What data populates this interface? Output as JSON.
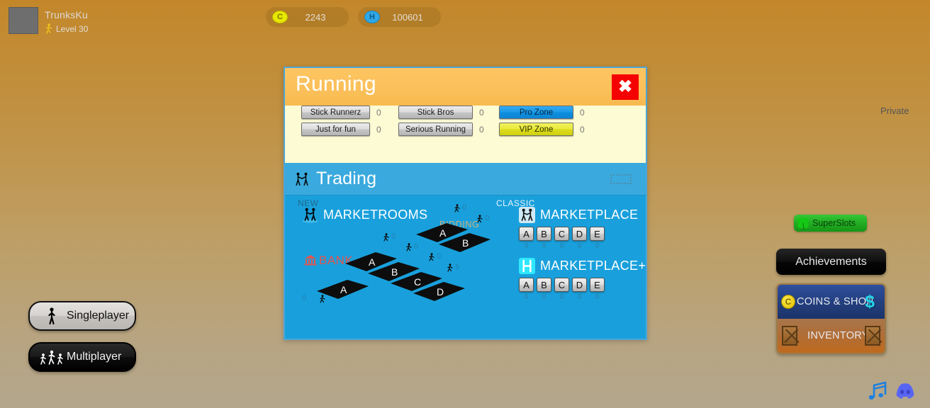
{
  "topbar": {
    "player_name": "TrunksKu",
    "level_text": "Level 30",
    "avatar_icon": "avatar-placeholder",
    "level_icon": "runner-icon",
    "currencies": [
      {
        "icon": "coin-icon",
        "label": "C",
        "value": "2243"
      },
      {
        "icon": "gem-icon",
        "label": "H",
        "value": "100601"
      }
    ]
  },
  "dialog": {
    "title": "Running",
    "close_icon": "close-icon",
    "close_label": "✖",
    "private_label": "Private",
    "rooms": [
      {
        "label": "Stick Runnerz",
        "count": "0",
        "style": "grey"
      },
      {
        "label": "Just for fun",
        "count": "0",
        "style": "grey"
      },
      {
        "label": "Stick Bros",
        "count": "0",
        "style": "grey"
      },
      {
        "label": "Serious Running",
        "count": "0",
        "style": "grey"
      },
      {
        "label": "Pro Zone",
        "count": "0",
        "style": "blue"
      },
      {
        "label": "VIP Zone",
        "count": "0",
        "style": "yellow"
      }
    ]
  },
  "trading": {
    "title": "Trading",
    "header_icon": "handshake-icon",
    "resize_icon": "resize-handle-icon",
    "new_tag": "NEW",
    "classic_tag": "CLASSIC",
    "marketrooms": {
      "name": "MARKETROOMS",
      "icon": "handshake-icon",
      "bank_label": "BANK",
      "bank_icon": "bank-icon",
      "bidding_label": "BIDDING",
      "rooms": [
        {
          "letter": "A",
          "count": "0",
          "group": "bank"
        },
        {
          "letter": "A",
          "count": "0",
          "group": "main"
        },
        {
          "letter": "B",
          "count": "0",
          "group": "main"
        },
        {
          "letter": "C",
          "count": "0",
          "group": "main"
        },
        {
          "letter": "D",
          "count": "5",
          "group": "main"
        },
        {
          "letter": "A",
          "count": "0",
          "group": "bidding"
        },
        {
          "letter": "B",
          "count": "0",
          "group": "bidding"
        }
      ]
    },
    "marketplace": {
      "name": "MARKETPLACE",
      "icon": "handshake-icon",
      "keys": [
        "A",
        "B",
        "C",
        "D",
        "E"
      ],
      "counts": [
        "0",
        "0",
        "0",
        "0",
        "0"
      ]
    },
    "marketplace_plus": {
      "name": "MARKETPLACE+",
      "icon": "marketplace-plus-icon",
      "keys": [
        "A",
        "B",
        "C",
        "D",
        "E"
      ],
      "counts": [
        "0",
        "0",
        "0",
        "0",
        "0"
      ]
    }
  },
  "left_buttons": [
    {
      "label": "Singleplayer",
      "icon": "single-runner-icon"
    },
    {
      "label": "Multiplayer",
      "icon": "multi-runner-icon"
    }
  ],
  "right_panel": {
    "superslots": {
      "label": "SuperSlots",
      "icon": "clover-icon"
    },
    "achievements": {
      "label": "Achievements"
    },
    "coins_shop": {
      "label": "COINS & SHOP",
      "coin_icon": "coin-icon",
      "dollar_icon": "dollar-icon"
    },
    "inventory": {
      "label": "INVENTORY",
      "icon": "crate-icon"
    }
  },
  "bottom_icons": [
    {
      "name": "music-icon"
    },
    {
      "name": "discord-icon"
    }
  ],
  "colors": {
    "accent_blue": "#19a0dc",
    "header_orange": "#fbc05a",
    "close_red": "#f50202",
    "panel_cream": "#fcfbd3",
    "bank_red": "#e5554d"
  }
}
